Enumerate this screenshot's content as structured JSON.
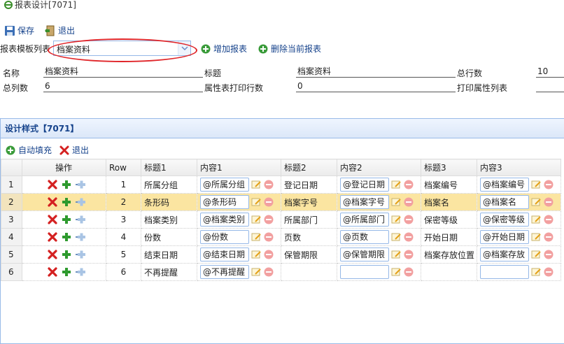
{
  "window": {
    "title": "报表设计[7071]"
  },
  "toolbar": {
    "save_label": "保存",
    "exit_label": "退出"
  },
  "template": {
    "label": "报表模板列表",
    "selected": "档案资料",
    "add_label": "增加报表",
    "delete_label": "删除当前报表"
  },
  "form": {
    "name_label": "名称",
    "name_value": "档案资料",
    "title_label": "标题",
    "title_value": "档案资料",
    "rows_label": "总行数",
    "rows_value": "10",
    "cols_label": "总列数",
    "cols_value": "6",
    "attr_rows_label": "属性表打印行数",
    "attr_rows_value": "0",
    "attr_cols_label": "打印属性列表",
    "attr_cols_value": ""
  },
  "panel": {
    "title": "设计样式【7071】",
    "autofill_label": "自动填充",
    "exit_label": "退出"
  },
  "grid": {
    "headers": [
      "",
      "操作",
      "Row",
      "标题1",
      "内容1",
      "标题2",
      "内容2",
      "标题3",
      "内容3"
    ],
    "selected_row": 1,
    "rows": [
      {
        "num": "1",
        "row": "1",
        "t1": "所属分组",
        "c1": "@所属分组",
        "t2": "登记日期",
        "c2": "@登记日期",
        "t3": "档案编号",
        "c3": "@档案编号"
      },
      {
        "num": "2",
        "row": "2",
        "t1": "条形码",
        "c1": "@条形码",
        "t2": "档案字号",
        "c2": "@档案字号",
        "t3": "档案名",
        "c3": "@档案名"
      },
      {
        "num": "3",
        "row": "3",
        "t1": "档案类别",
        "c1": "@档案类别",
        "t2": "所属部门",
        "c2": "@所属部门",
        "t3": "保密等级",
        "c3": "@保密等级"
      },
      {
        "num": "4",
        "row": "4",
        "t1": "份数",
        "c1": "@份数",
        "t2": "页数",
        "c2": "@页数",
        "t3": "开始日期",
        "c3": "@开始日期"
      },
      {
        "num": "5",
        "row": "5",
        "t1": "结束日期",
        "c1": "@结束日期",
        "t2": "保管期限",
        "c2": "@保管期限",
        "t3": "档案存放位置",
        "c3": "@档案存放"
      },
      {
        "num": "6",
        "row": "6",
        "t1": "不再提醒",
        "c1": "@不再提醒",
        "t2": "",
        "c2": "",
        "t3": "",
        "c3": ""
      }
    ]
  },
  "colors": {
    "link": "#15428b",
    "selected_row": "#fbe5a1",
    "panel_border": "#99bbe8",
    "highlight_ellipse": "#e0262a"
  }
}
